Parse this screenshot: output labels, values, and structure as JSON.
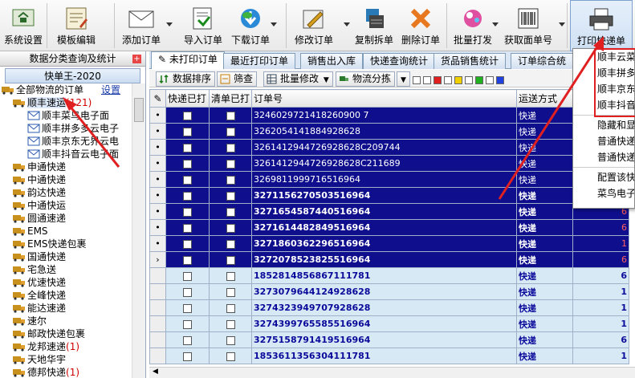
{
  "toolbar": [
    {
      "label": "系统设置",
      "icon": "system-settings-icon"
    },
    {
      "label": "模板编辑",
      "icon": "template-edit-icon"
    },
    {
      "label": "添加订单",
      "icon": "add-order-icon"
    },
    {
      "label": "导入订单",
      "icon": "import-order-icon"
    },
    {
      "label": "下载订单",
      "icon": "download-order-icon"
    },
    {
      "label": "修改订单",
      "icon": "edit-order-icon"
    },
    {
      "label": "复制拆单",
      "icon": "copy-split-icon"
    },
    {
      "label": "删除订单",
      "icon": "delete-order-icon"
    },
    {
      "label": "批量打发",
      "icon": "batch-print-icon"
    },
    {
      "label": "获取面单号",
      "icon": "get-waybill-icon"
    },
    {
      "label": "打印快递单",
      "icon": "printer-icon"
    }
  ],
  "left_panel": {
    "title": "数据分类查询及统计",
    "shop": "快单王-2020",
    "root": "全部物流的订单",
    "settings": "设置",
    "tree": [
      {
        "label": "顺丰速运",
        "count": "(121)",
        "level": 1,
        "kind": "truck"
      },
      {
        "label": "顺丰菜鸟电子面",
        "count": "",
        "level": 2,
        "kind": "mail"
      },
      {
        "label": "顺丰拼多多云电子",
        "count": "",
        "level": 2,
        "kind": "mail"
      },
      {
        "label": "顺丰京东无界云电",
        "count": "",
        "level": 2,
        "kind": "mail"
      },
      {
        "label": "顺丰抖音云电子面",
        "count": "",
        "level": 2,
        "kind": "mail"
      },
      {
        "label": "申通快递",
        "count": "",
        "level": 1,
        "kind": "truck"
      },
      {
        "label": "中通快递",
        "count": "",
        "level": 1,
        "kind": "truck"
      },
      {
        "label": "韵达快递",
        "count": "",
        "level": 1,
        "kind": "truck"
      },
      {
        "label": "中通快运",
        "count": "",
        "level": 1,
        "kind": "truck"
      },
      {
        "label": "圆通速递",
        "count": "",
        "level": 1,
        "kind": "truck"
      },
      {
        "label": "EMS",
        "count": "",
        "level": 1,
        "kind": "truck"
      },
      {
        "label": "EMS快递包裹",
        "count": "",
        "level": 1,
        "kind": "truck"
      },
      {
        "label": "国通快递",
        "count": "",
        "level": 1,
        "kind": "truck"
      },
      {
        "label": "宅急送",
        "count": "",
        "level": 1,
        "kind": "truck"
      },
      {
        "label": "优速快递",
        "count": "",
        "level": 1,
        "kind": "truck"
      },
      {
        "label": "全峰快递",
        "count": "",
        "level": 1,
        "kind": "truck"
      },
      {
        "label": "能达速递",
        "count": "",
        "level": 1,
        "kind": "truck"
      },
      {
        "label": "速尔",
        "count": "",
        "level": 1,
        "kind": "truck"
      },
      {
        "label": "邮政快递包裹",
        "count": "",
        "level": 1,
        "kind": "truck"
      },
      {
        "label": "龙邦速递",
        "count": "(1)",
        "level": 1,
        "kind": "truck"
      },
      {
        "label": "天地华宇",
        "count": "",
        "level": 1,
        "kind": "truck"
      },
      {
        "label": "德邦快递",
        "count": "(1)",
        "level": 1,
        "kind": "truck"
      }
    ]
  },
  "tabs": [
    "未打印订单",
    "最近打印订单",
    "销售出入库",
    "快递查询统计",
    "货品销售统计",
    "订单综合统"
  ],
  "subtoolbar": {
    "sort": "数据排序",
    "filter": "筛查",
    "batch_edit": "批量修改",
    "split": "物流分拣"
  },
  "grid": {
    "headers": [
      "快递已打",
      "清单已打",
      "订单号",
      "运送方式"
    ],
    "rows": [
      {
        "order": "3246029721418260900 7",
        "method": "快递",
        "qty": "",
        "state": "sel",
        "ind": "•"
      },
      {
        "order": "3262054141884928628",
        "method": "快递",
        "qty": "",
        "state": "sel",
        "ind": "•"
      },
      {
        "order": "3261412944726928628C209744",
        "method": "快递",
        "qty": "",
        "state": "sel",
        "ind": "•"
      },
      {
        "order": "3261412944726928628C211689",
        "method": "快递",
        "qty": "",
        "state": "sel",
        "ind": "•"
      },
      {
        "order": "3269811999716516964",
        "method": "快递",
        "qty": "",
        "state": "sel",
        "ind": "•"
      },
      {
        "order": "3271156270503516964",
        "method": "快递",
        "qty": "",
        "state": "selb",
        "ind": "•"
      },
      {
        "order": "3271654587440516964",
        "method": "快递",
        "qty": "6",
        "state": "selb",
        "ind": "•"
      },
      {
        "order": "3271614482849516964",
        "method": "快递",
        "qty": "6",
        "state": "selb",
        "ind": "•"
      },
      {
        "order": "3271860362296516964",
        "method": "快递",
        "qty": "1",
        "state": "selb",
        "ind": "•"
      },
      {
        "order": "3272078523825516964",
        "method": "快递",
        "qty": "6",
        "state": "selb",
        "ind": "›"
      },
      {
        "order": "1852814856867111781",
        "method": "快递",
        "qty": "6",
        "state": "nor",
        "ind": ""
      },
      {
        "order": "3273079644124928628",
        "method": "快递",
        "qty": "1",
        "state": "nor",
        "ind": ""
      },
      {
        "order": "3274323949707928628",
        "method": "快递",
        "qty": "1",
        "state": "nor",
        "ind": ""
      },
      {
        "order": "3274399765585516964",
        "method": "快递",
        "qty": "1",
        "state": "nor",
        "ind": ""
      },
      {
        "order": "3275158791419516964",
        "method": "快递",
        "qty": "6",
        "state": "nor",
        "ind": ""
      },
      {
        "order": "1853611356304111781",
        "method": "快递",
        "qty": "1",
        "state": "nor",
        "ind": ""
      }
    ]
  },
  "popup": {
    "items": [
      "顺丰云菜",
      "顺丰拼多",
      "顺丰京东",
      "顺丰抖音",
      "隐藏和显",
      "普通快递",
      "普通快递",
      "配置该快",
      "菜鸟电子"
    ]
  }
}
